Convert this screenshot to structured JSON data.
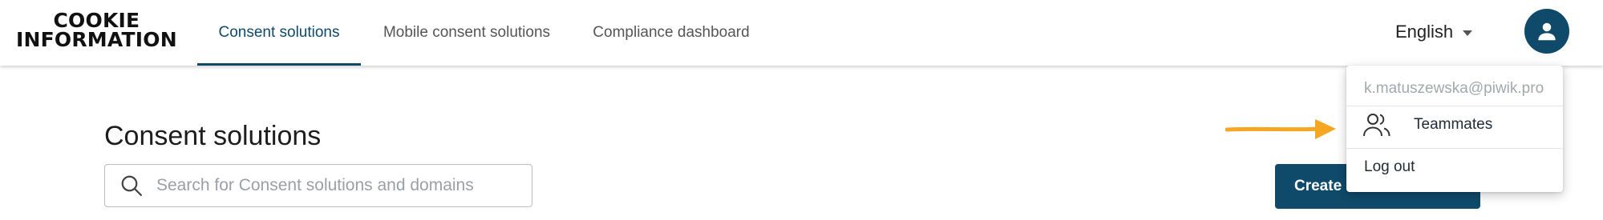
{
  "brand": {
    "line1": "COOKIE",
    "line2": "INFORMATION"
  },
  "nav": {
    "tabs": [
      {
        "label": "Consent solutions",
        "active": true
      },
      {
        "label": "Mobile consent solutions",
        "active": false
      },
      {
        "label": "Compliance dashboard",
        "active": false
      }
    ]
  },
  "language": {
    "label": "English",
    "icon": "caret-down-icon"
  },
  "user": {
    "avatar_icon": "person-icon"
  },
  "main": {
    "title": "Consent solutions",
    "search": {
      "placeholder": "Search for Consent solutions and domains",
      "value": ""
    },
    "create_button_label": "Create"
  },
  "account_menu": {
    "email": "k.matuszewska@piwik.pro",
    "items": [
      {
        "label": "Teammates",
        "icon": "people-icon"
      },
      {
        "label": "Log out"
      }
    ]
  },
  "annotation": {
    "icon": "arrow-right-icon"
  },
  "colors": {
    "primary": "#0f4a6b",
    "tab_text": "#555555",
    "arrow": "#f5a623",
    "email": "#a3a8ad"
  }
}
